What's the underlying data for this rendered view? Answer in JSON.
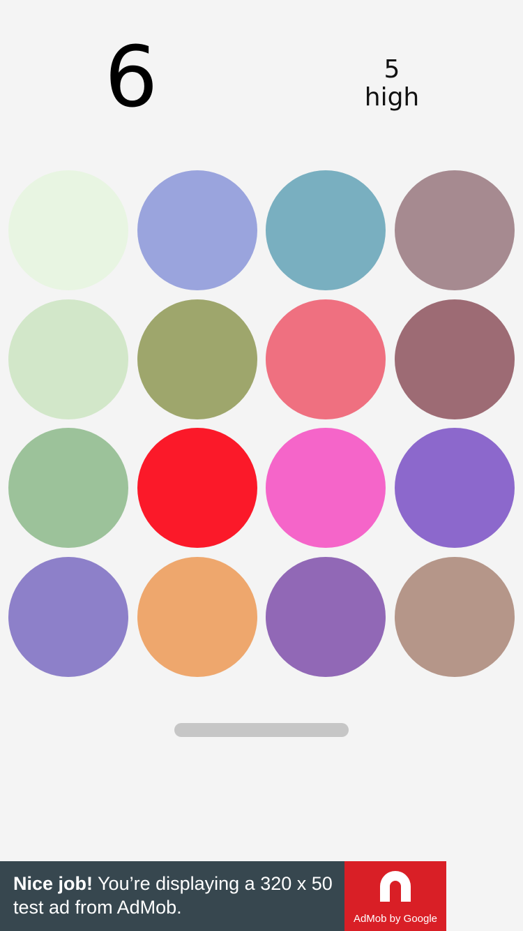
{
  "game": {
    "score": "6",
    "high_score": "5",
    "high_label": "high",
    "circles": [
      "#e8f5e2",
      "#9aa4dd",
      "#79afc0",
      "#a68a90",
      "#d2e7c9",
      "#9ea66c",
      "#ef7080",
      "#9d6b74",
      "#9cc29a",
      "#fb1929",
      "#f565c9",
      "#8c68cc",
      "#8d80c9",
      "#eea76d",
      "#9168b6",
      "#b59689"
    ]
  },
  "ad": {
    "headline": "Nice job!",
    "body": "You’re displaying a 320 x 50 test ad from AdMob.",
    "logo_caption": "AdMob by Google",
    "logo_icon": "admob-logo-icon",
    "background": "#37474f",
    "logo_background": "#d91f26"
  }
}
